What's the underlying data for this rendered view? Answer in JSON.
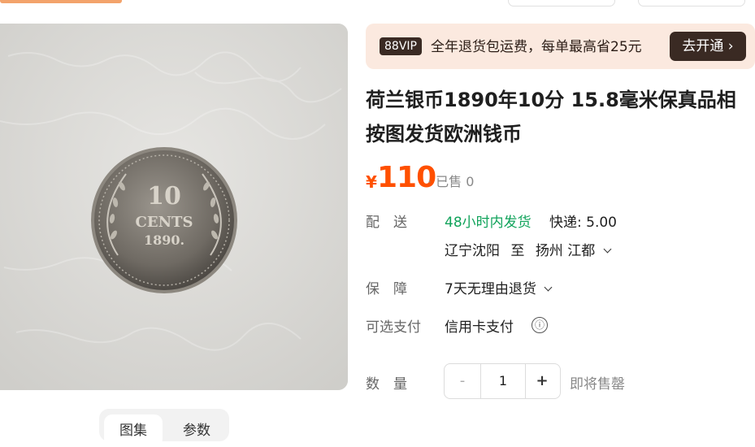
{
  "image": {
    "alt": ""
  },
  "tabs": [
    {
      "label": "图集"
    },
    {
      "label": "参数"
    }
  ],
  "vip": {
    "badge": "88VIP",
    "text": "全年退货包运费，每单最高省25元",
    "cta": "去开通 ›"
  },
  "product": {
    "title": "荷兰银币1890年10分 15.8毫米保真品相按图发货欧洲钱币",
    "currency": "¥",
    "price": "110",
    "sold": "· 已售 0"
  },
  "delivery": {
    "label": "配　送",
    "promise": "48小时内发货",
    "shipping": "快递: 5.00",
    "from": "辽宁沈阳",
    "to_word": "至",
    "to": "扬州 江都"
  },
  "guarantee": {
    "label": "保　障",
    "value": "7天无理由退货"
  },
  "payment": {
    "label": "可选支付",
    "value": "信用卡支付",
    "info_icon": "ⓘ"
  },
  "quantity": {
    "label": "数　量",
    "minus": "-",
    "value": "1",
    "plus": "+",
    "status": "即将售罄"
  },
  "coin_text": {
    "value": "10",
    "unit": "CENTS",
    "year": "1890."
  }
}
